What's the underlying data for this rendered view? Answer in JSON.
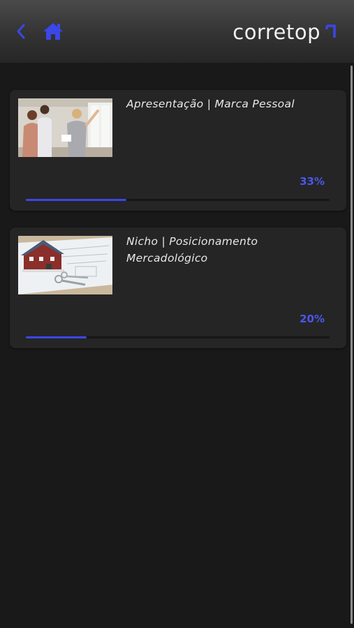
{
  "header": {
    "back_icon": "chevron-left-icon",
    "home_icon": "home-icon",
    "logo_text": "corretop",
    "accent_color": "#3b47e6"
  },
  "courses": [
    {
      "title": "Apresentação | Marca Pessoal",
      "percent_label": "33%",
      "progress": 0.33,
      "image": "photo: real estate agent presenting to a couple in a bright apartment"
    },
    {
      "title": "Nicho | Posicionamento Mercadológico",
      "percent_label": "20%",
      "progress": 0.2,
      "image": "photo: small house model on blueprints with a set of keys"
    }
  ]
}
